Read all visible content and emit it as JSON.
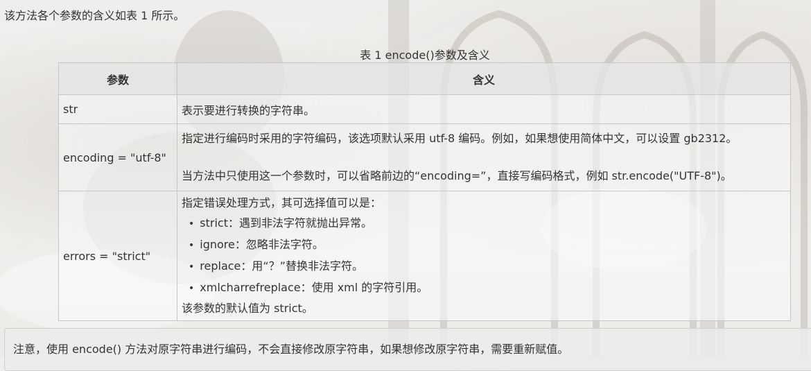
{
  "intro": "该方法各个参数的含义如表 1 所示。",
  "table": {
    "caption": "表 1 encode()参数及含义",
    "headers": [
      "参数",
      "含义"
    ],
    "rows": [
      {
        "param": "str",
        "meaning": "表示要进行转换的字符串。"
      },
      {
        "param": "encoding = \"utf-8\"",
        "meaning_lines": [
          "指定进行编码时采用的字符编码，该选项默认采用 utf-8 编码。例如，如果想使用简体中文，可以设置 gb2312。",
          "当方法中只使用这一个参数时，可以省略前边的“encoding=”，直接写编码格式，例如 str.encode(\"UTF-8\")。"
        ]
      },
      {
        "param": "errors = \"strict\"",
        "meaning_intro": "指定错误处理方式，其可选择值可以是：",
        "options": [
          "strict：遇到非法字符就抛出异常。",
          "ignore：忽略非法字符。",
          "replace：用“？”替换非法字符。",
          "xmlcharrefreplace：使用 xml 的字符引用。"
        ],
        "meaning_outro": "该参数的默认值为 strict。"
      }
    ]
  },
  "note": "注意，使用 encode() 方法对原字符串进行编码，不会直接修改原字符串，如果想修改原字符串，需要重新赋值。"
}
